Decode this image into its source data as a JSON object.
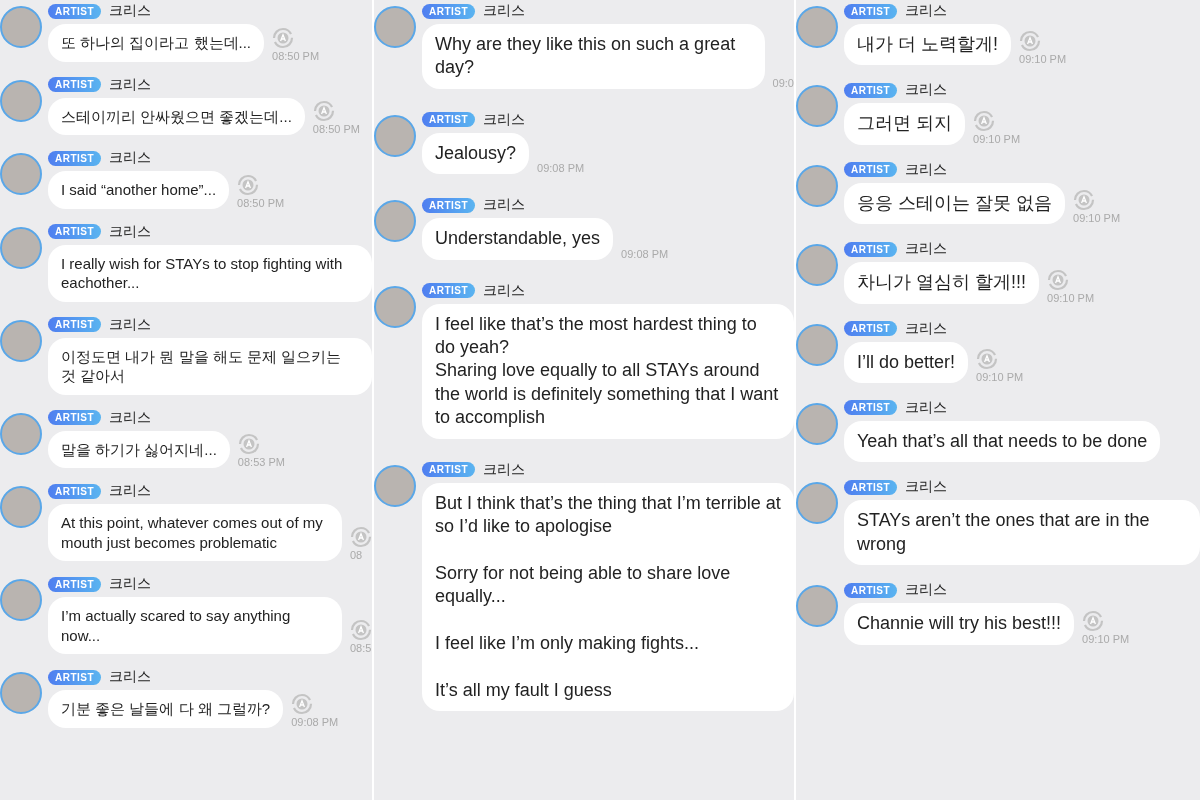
{
  "columns": [
    {
      "messages": [
        {
          "badge": "ARTIST",
          "sender": "크리스",
          "text": "또 하나의 집이라고 했는데...",
          "icon": true,
          "time": "08:50 PM"
        },
        {
          "badge": "ARTIST",
          "sender": "크리스",
          "text": "스테이끼리 안싸웠으면 좋겠는데...",
          "icon": true,
          "time": "08:50 PM"
        },
        {
          "badge": "ARTIST",
          "sender": "크리스",
          "text": "I said “another home”...",
          "icon": true,
          "time": "08:50 PM"
        },
        {
          "badge": "ARTIST",
          "sender": "크리스",
          "text": "I really wish for STAYs to stop fighting with eachother...",
          "icon": false
        },
        {
          "badge": "ARTIST",
          "sender": "크리스",
          "text": "이정도면 내가 뭔 말을 해도 문제 일으키는 것 같아서",
          "icon": false
        },
        {
          "badge": "ARTIST",
          "sender": "크리스",
          "text": "말을 하기가 싫어지네...",
          "icon": true,
          "time": "08:53 PM"
        },
        {
          "badge": "ARTIST",
          "sender": "크리스",
          "text": "At this point, whatever comes out of my mouth just becomes problematic",
          "icon": true,
          "time": "08"
        },
        {
          "badge": "ARTIST",
          "sender": "크리스",
          "text": "I’m actually scared to say anything now...",
          "icon": true,
          "time": "08:5"
        },
        {
          "badge": "ARTIST",
          "sender": "크리스",
          "text": "기분 좋은 날들에 다 왜 그럴까?",
          "icon": true,
          "time": "09:08 PM"
        }
      ]
    },
    {
      "messages": [
        {
          "badge": "ARTIST",
          "sender": "크리스",
          "text": "Why are they like this on such a great day?",
          "icon": false,
          "time": "09:0"
        },
        {
          "badge": "ARTIST",
          "sender": "크리스",
          "text": "Jealousy?",
          "icon": false,
          "time": "09:08 PM"
        },
        {
          "badge": "ARTIST",
          "sender": "크리스",
          "text": "Understandable, yes",
          "icon": false,
          "time": "09:08 PM"
        },
        {
          "badge": "ARTIST",
          "sender": "크리스",
          "text": "I feel like that’s the most hardest thing to do yeah?\nSharing love equally to all STAYs around the world is definitely something that I want to accomplish",
          "icon": false
        },
        {
          "badge": "ARTIST",
          "sender": "크리스",
          "text": "But I think that’s the thing that I’m terrible at so I’d like to apologise\n\nSorry for not being able to share love equally...\n\nI feel like I’m only making fights...\n\nIt’s all my fault I guess",
          "icon": false
        }
      ]
    },
    {
      "messages": [
        {
          "badge": "ARTIST",
          "sender": "크리스",
          "text": "내가 더 노력할게!",
          "icon": true,
          "time": "09:10 PM"
        },
        {
          "badge": "ARTIST",
          "sender": "크리스",
          "text": "그러면 되지",
          "icon": true,
          "time": "09:10 PM"
        },
        {
          "badge": "ARTIST",
          "sender": "크리스",
          "text": "응응 스테이는 잘못 없음",
          "icon": true,
          "time": "09:10 PM"
        },
        {
          "badge": "ARTIST",
          "sender": "크리스",
          "text": "차니가 열심히 할게!!!",
          "icon": true,
          "time": "09:10 PM"
        },
        {
          "badge": "ARTIST",
          "sender": "크리스",
          "text": "I’ll do better!",
          "icon": true,
          "time": "09:10 PM"
        },
        {
          "badge": "ARTIST",
          "sender": "크리스",
          "text": "Yeah that’s all that needs to be done",
          "icon": false
        },
        {
          "badge": "ARTIST",
          "sender": "크리스",
          "text": "STAYs aren’t the ones that are in the wrong",
          "icon": false
        },
        {
          "badge": "ARTIST",
          "sender": "크리스",
          "text": "Channie will try his best!!!",
          "icon": true,
          "time": "09:10 PM"
        }
      ]
    }
  ]
}
